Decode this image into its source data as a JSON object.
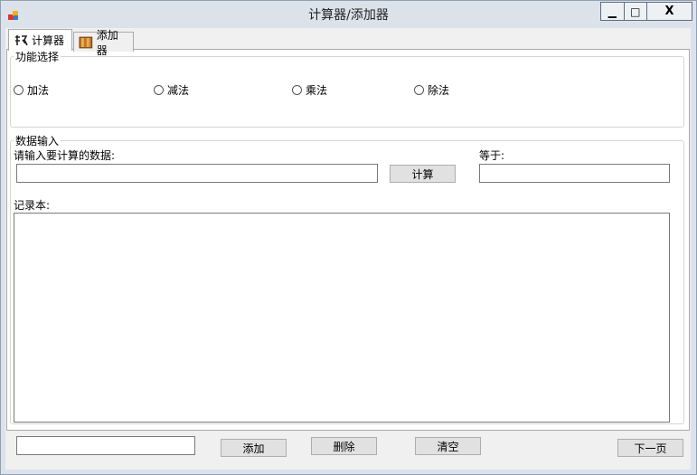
{
  "window": {
    "title": "计算器/添加器",
    "minimize_glyph": "▁",
    "maximize_glyph": "□",
    "close_glyph": "X"
  },
  "tabs": [
    {
      "label": "计算器",
      "icon": "calculator-icon",
      "active": true
    },
    {
      "label": "添加器",
      "icon": "book-icon",
      "active": false
    }
  ],
  "function_group": {
    "title": "功能选择",
    "options": [
      {
        "label": "加法",
        "checked": false
      },
      {
        "label": "减法",
        "checked": false
      },
      {
        "label": "乘法",
        "checked": false
      },
      {
        "label": "除法",
        "checked": false
      }
    ]
  },
  "data_group": {
    "title": "数据输入",
    "input_label": "请输入要计算的数据:",
    "input_value": "",
    "calc_button": "计算",
    "equals_label": "等于:",
    "result_value": "",
    "log_label": "记录本:",
    "log_value": ""
  },
  "bottom": {
    "input_value": "",
    "add_button": "添加",
    "delete_button": "删除",
    "clear_button": "清空",
    "next_button": "下一页"
  }
}
